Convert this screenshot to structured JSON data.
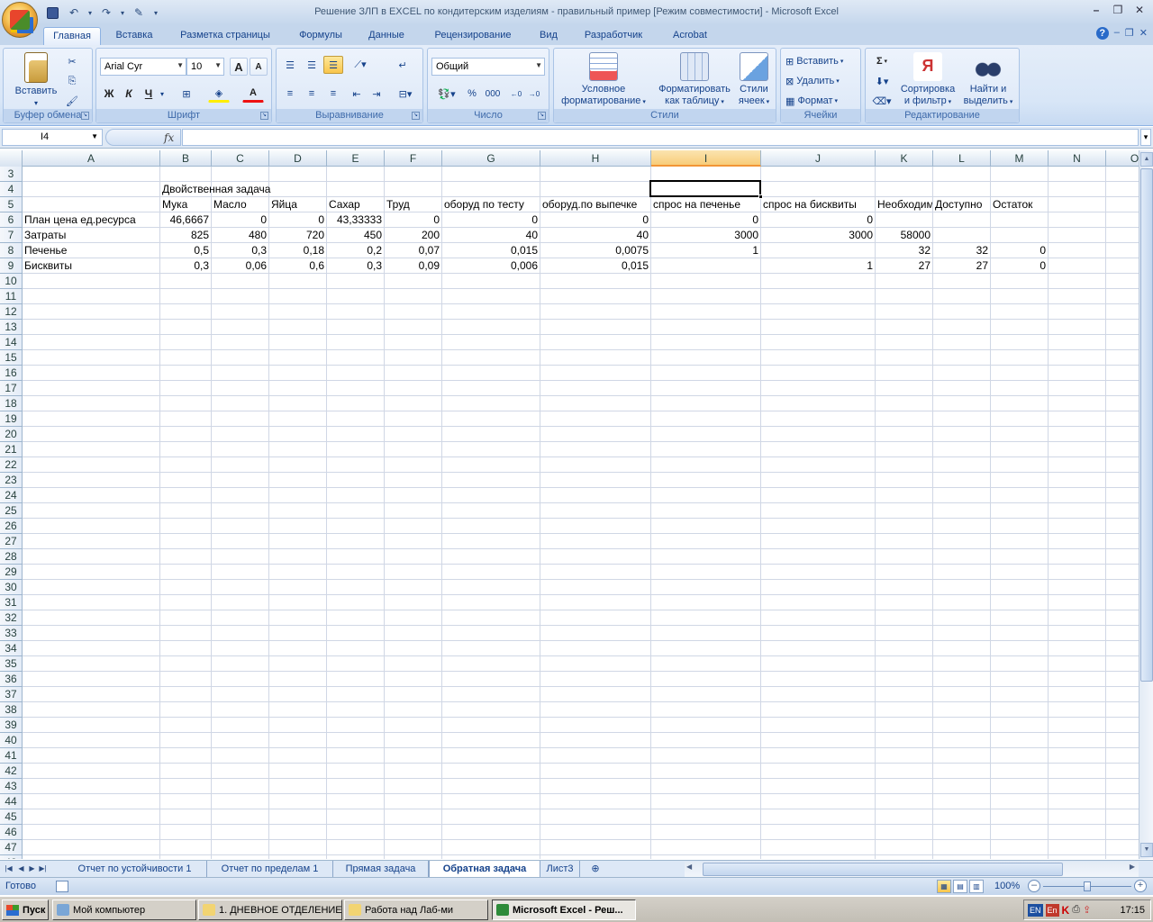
{
  "window": {
    "title": "Решение ЗЛП в EXCEL по кондитерским изделиям - правильный пример  [Режим совместимости] - Microsoft Excel"
  },
  "ribbon_tabs": [
    "Главная",
    "Вставка",
    "Разметка страницы",
    "Формулы",
    "Данные",
    "Рецензирование",
    "Вид",
    "Разработчик",
    "Acrobat"
  ],
  "ribbon": {
    "clipboard": {
      "label": "Буфер обмена",
      "paste": "Вставить"
    },
    "font": {
      "label": "Шрифт",
      "font_name": "Arial Cyr",
      "font_size": "10",
      "bold": "Ж",
      "italic": "К",
      "underline": "Ч",
      "grow": "A",
      "shrink": "A",
      "font_color": "A"
    },
    "alignment": {
      "label": "Выравнивание"
    },
    "number": {
      "label": "Число",
      "format": "Общий",
      "percent": "%",
      "thousands": "000"
    },
    "styles": {
      "label": "Стили",
      "conditional_1": "Условное",
      "conditional_2": "форматирование",
      "as_table_1": "Форматировать",
      "as_table_2": "как таблицу",
      "cell_styles_1": "Стили",
      "cell_styles_2": "ячеек"
    },
    "cells": {
      "label": "Ячейки",
      "insert": "Вставить",
      "delete": "Удалить",
      "format": "Формат"
    },
    "editing": {
      "label": "Редактирование",
      "sum": "Σ",
      "sort_1": "Сортировка",
      "sort_2": "и фильтр",
      "find_1": "Найти и",
      "find_2": "выделить"
    }
  },
  "formula_bar": {
    "name_box": "I4",
    "fx": "fx",
    "formula": ""
  },
  "columns": [
    {
      "name": "A",
      "w": 153
    },
    {
      "name": "B",
      "w": 57
    },
    {
      "name": "C",
      "w": 64
    },
    {
      "name": "D",
      "w": 64
    },
    {
      "name": "E",
      "w": 64
    },
    {
      "name": "F",
      "w": 64
    },
    {
      "name": "G",
      "w": 109
    },
    {
      "name": "H",
      "w": 123
    },
    {
      "name": "I",
      "w": 122
    },
    {
      "name": "J",
      "w": 127
    },
    {
      "name": "K",
      "w": 64
    },
    {
      "name": "L",
      "w": 64
    },
    {
      "name": "M",
      "w": 64
    },
    {
      "name": "N",
      "w": 64
    },
    {
      "name": "O",
      "w": 64
    }
  ],
  "first_row": 3,
  "last_row": 48,
  "active_cell": {
    "col": 8,
    "row": 4
  },
  "cells": [
    {
      "c": 1,
      "r": 4,
      "v": "Двойственная задача"
    },
    {
      "c": 1,
      "r": 5,
      "v": "Мука"
    },
    {
      "c": 2,
      "r": 5,
      "v": "Масло"
    },
    {
      "c": 3,
      "r": 5,
      "v": "Яйца"
    },
    {
      "c": 4,
      "r": 5,
      "v": "Сахар"
    },
    {
      "c": 5,
      "r": 5,
      "v": "Труд"
    },
    {
      "c": 6,
      "r": 5,
      "v": "оборуд по тесту"
    },
    {
      "c": 7,
      "r": 5,
      "v": "оборуд.по выпечке"
    },
    {
      "c": 8,
      "r": 5,
      "v": "спрос на печенье"
    },
    {
      "c": 9,
      "r": 5,
      "v": "спрос на бисквиты"
    },
    {
      "c": 10,
      "r": 5,
      "v": "Необходимо",
      "clip": true
    },
    {
      "c": 11,
      "r": 5,
      "v": "Доступно"
    },
    {
      "c": 12,
      "r": 5,
      "v": "Остаток"
    },
    {
      "c": 0,
      "r": 6,
      "v": "План цена ед.ресурса"
    },
    {
      "c": 1,
      "r": 6,
      "v": "46,6667",
      "n": true
    },
    {
      "c": 2,
      "r": 6,
      "v": "0",
      "n": true
    },
    {
      "c": 3,
      "r": 6,
      "v": "0",
      "n": true
    },
    {
      "c": 4,
      "r": 6,
      "v": "43,33333",
      "n": true
    },
    {
      "c": 5,
      "r": 6,
      "v": "0",
      "n": true
    },
    {
      "c": 6,
      "r": 6,
      "v": "0",
      "n": true
    },
    {
      "c": 7,
      "r": 6,
      "v": "0",
      "n": true
    },
    {
      "c": 8,
      "r": 6,
      "v": "0",
      "n": true
    },
    {
      "c": 9,
      "r": 6,
      "v": "0",
      "n": true
    },
    {
      "c": 0,
      "r": 7,
      "v": "Затраты"
    },
    {
      "c": 1,
      "r": 7,
      "v": "825",
      "n": true
    },
    {
      "c": 2,
      "r": 7,
      "v": "480",
      "n": true
    },
    {
      "c": 3,
      "r": 7,
      "v": "720",
      "n": true
    },
    {
      "c": 4,
      "r": 7,
      "v": "450",
      "n": true
    },
    {
      "c": 5,
      "r": 7,
      "v": "200",
      "n": true
    },
    {
      "c": 6,
      "r": 7,
      "v": "40",
      "n": true
    },
    {
      "c": 7,
      "r": 7,
      "v": "40",
      "n": true
    },
    {
      "c": 8,
      "r": 7,
      "v": "3000",
      "n": true
    },
    {
      "c": 9,
      "r": 7,
      "v": "3000",
      "n": true
    },
    {
      "c": 10,
      "r": 7,
      "v": "58000",
      "n": true
    },
    {
      "c": 0,
      "r": 8,
      "v": "Печенье"
    },
    {
      "c": 1,
      "r": 8,
      "v": "0,5",
      "n": true
    },
    {
      "c": 2,
      "r": 8,
      "v": "0,3",
      "n": true
    },
    {
      "c": 3,
      "r": 8,
      "v": "0,18",
      "n": true
    },
    {
      "c": 4,
      "r": 8,
      "v": "0,2",
      "n": true
    },
    {
      "c": 5,
      "r": 8,
      "v": "0,07",
      "n": true
    },
    {
      "c": 6,
      "r": 8,
      "v": "0,015",
      "n": true
    },
    {
      "c": 7,
      "r": 8,
      "v": "0,0075",
      "n": true
    },
    {
      "c": 8,
      "r": 8,
      "v": "1",
      "n": true
    },
    {
      "c": 10,
      "r": 8,
      "v": "32",
      "n": true
    },
    {
      "c": 11,
      "r": 8,
      "v": "32",
      "n": true
    },
    {
      "c": 12,
      "r": 8,
      "v": "0",
      "n": true
    },
    {
      "c": 0,
      "r": 9,
      "v": "Бисквиты"
    },
    {
      "c": 1,
      "r": 9,
      "v": "0,3",
      "n": true
    },
    {
      "c": 2,
      "r": 9,
      "v": "0,06",
      "n": true
    },
    {
      "c": 3,
      "r": 9,
      "v": "0,6",
      "n": true
    },
    {
      "c": 4,
      "r": 9,
      "v": "0,3",
      "n": true
    },
    {
      "c": 5,
      "r": 9,
      "v": "0,09",
      "n": true
    },
    {
      "c": 6,
      "r": 9,
      "v": "0,006",
      "n": true
    },
    {
      "c": 7,
      "r": 9,
      "v": "0,015",
      "n": true
    },
    {
      "c": 9,
      "r": 9,
      "v": "1",
      "n": true
    },
    {
      "c": 10,
      "r": 9,
      "v": "27",
      "n": true
    },
    {
      "c": 11,
      "r": 9,
      "v": "27",
      "n": true
    },
    {
      "c": 12,
      "r": 9,
      "v": "0",
      "n": true
    }
  ],
  "sheet_tabs": [
    {
      "label": "Отчет по устойчивости 1",
      "active": false
    },
    {
      "label": "Отчет по пределам 1",
      "active": false
    },
    {
      "label": "Прямая задача",
      "active": false
    },
    {
      "label": "Обратная задача",
      "active": true
    },
    {
      "label": "Лист3",
      "active": false
    }
  ],
  "status": {
    "text": "Готово",
    "zoom": "100%"
  },
  "taskbar": {
    "start": "Пуск",
    "items": [
      {
        "label": "Мой компьютер",
        "pressed": false
      },
      {
        "label": "1. ДНЕВНОЕ ОТДЕЛЕНИЕ",
        "pressed": false
      },
      {
        "label": "Работа над Лаб-ми",
        "pressed": false
      },
      {
        "label": "Microsoft Excel - Реш...",
        "pressed": true
      }
    ],
    "lang_1": "EN",
    "lang_2": "En",
    "clock": "17:15"
  }
}
